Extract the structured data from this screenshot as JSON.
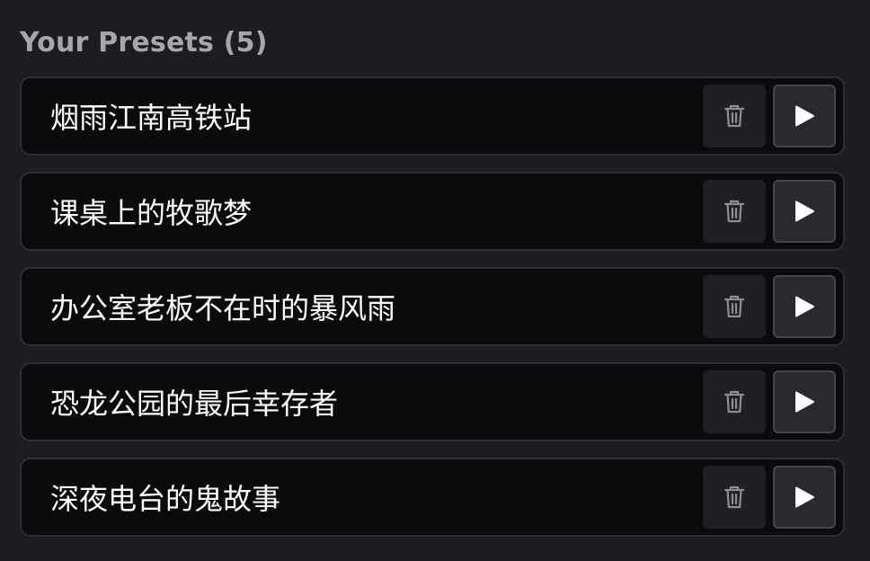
{
  "section": {
    "title": "Your Presets (5)"
  },
  "presets": [
    {
      "name": "烟雨江南高铁站"
    },
    {
      "name": "课桌上的牧歌梦"
    },
    {
      "name": "办公室老板不在时的暴风雨"
    },
    {
      "name": "恐龙公园的最后幸存者"
    },
    {
      "name": "深夜电台的鬼故事"
    }
  ],
  "icons": {
    "delete": "trash-icon",
    "play": "play-icon"
  },
  "colors": {
    "background": "#1d1c20",
    "row_background": "#0b0a0d",
    "row_border": "#2e2d33",
    "title_text": "#a8a6ad",
    "item_text": "#ffffff",
    "trash_icon": "#8e8d93",
    "play_icon": "#ffffff"
  }
}
